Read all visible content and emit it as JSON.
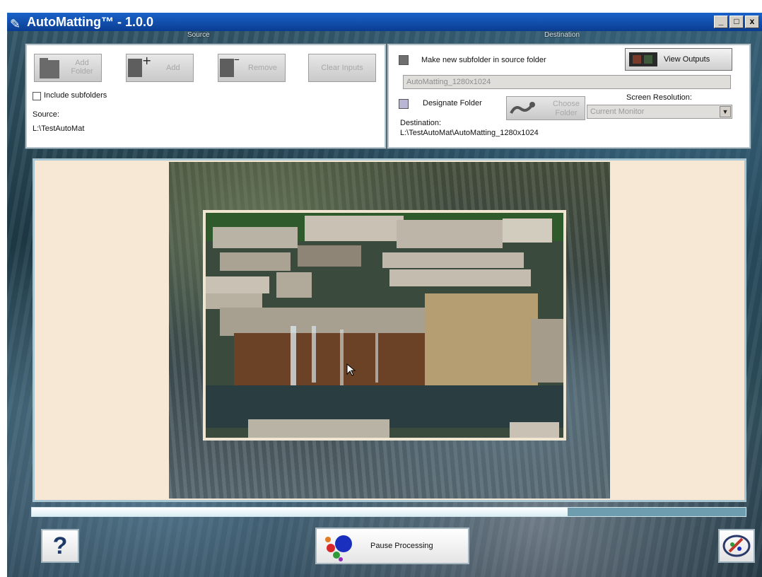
{
  "window": {
    "title": "AutoMatting™ - 1.0.0",
    "app_icon": "pencil-logo-icon",
    "controls": [
      "minimize",
      "maximize",
      "close"
    ]
  },
  "source_panel": {
    "section_label": "Source",
    "add_folder_label": "Add Folder",
    "add_label": "Add",
    "remove_label": "Remove",
    "clear_inputs_label": "Clear Inputs",
    "include_subfolders_label": "Include subfolders",
    "source_label": "Source:",
    "source_value": "L:\\TestAutoMat"
  },
  "destination_panel": {
    "section_label": "Destination",
    "make_subfolder_label": "Make new subfolder in source folder",
    "subfolder_name_value": "AutoMatting_1280x1024",
    "view_outputs_label": "View Outputs",
    "designate_folder_label": "Designate Folder",
    "choose_folder_label": "Choose Folder",
    "screen_resolution_label": "Screen Resolution:",
    "screen_resolution_value": "Current Monitor",
    "destination_label": "Destination:",
    "destination_value": "L:\\TestAutoMat\\AutoMatting_1280x1024"
  },
  "progress": {
    "fraction": 0.75
  },
  "footer": {
    "help_label": "?",
    "pause_label": "Pause Processing",
    "logo_icon": "pencil-logo-icon"
  },
  "colors": {
    "titlebar": "#0b3d91",
    "matte_background": "#f6e8d4",
    "progress_fill": "#ffffff"
  }
}
